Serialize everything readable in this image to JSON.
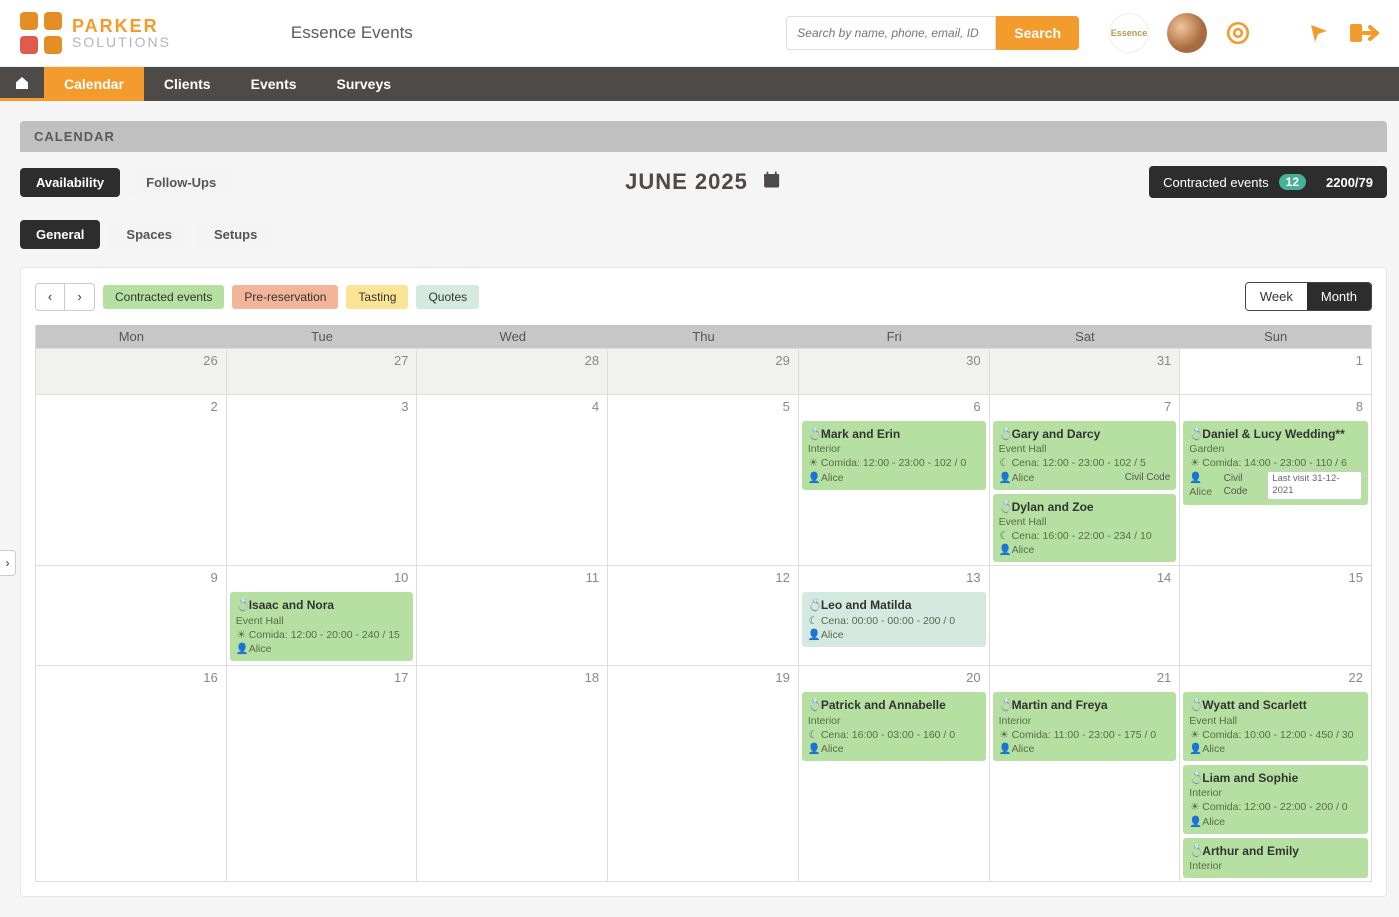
{
  "brand": {
    "line1": "PARKER",
    "line2": "SOLUTIONS"
  },
  "header": {
    "title": "Essence Events",
    "company_badge": "Essence"
  },
  "search": {
    "placeholder": "Search by name, phone, email, ID",
    "button": "Search"
  },
  "nav": {
    "home": "",
    "calendar": "Calendar",
    "clients": "Clients",
    "events": "Events",
    "surveys": "Surveys"
  },
  "section_title": "CALENDAR",
  "tabs_primary": {
    "availability": "Availability",
    "followups": "Follow-Ups"
  },
  "month_label": "JUNE 2025",
  "contracted_label": "Contracted events",
  "contracted_count": "12",
  "contracted_right": "2200/79",
  "tabs_secondary": {
    "general": "General",
    "spaces": "Spaces",
    "setups": "Setups"
  },
  "legend": {
    "contracted": "Contracted events",
    "pre": "Pre-reservation",
    "tasting": "Tasting",
    "quotes": "Quotes"
  },
  "view": {
    "week": "Week",
    "month": "Month"
  },
  "weekdays": {
    "mon": "Mon",
    "tue": "Tue",
    "wed": "Wed",
    "thu": "Thu",
    "fri": "Fri",
    "sat": "Sat",
    "sun": "Sun"
  },
  "grid": {
    "r0": [
      "26",
      "27",
      "28",
      "29",
      "30",
      "31",
      "1"
    ],
    "r1": [
      "2",
      "3",
      "4",
      "5",
      "6",
      "7",
      "8"
    ],
    "r2": [
      "9",
      "10",
      "11",
      "12",
      "13",
      "14",
      "15"
    ],
    "r3": [
      "16",
      "17",
      "18",
      "19",
      "20",
      "21",
      "22"
    ]
  },
  "events": {
    "mark_erin": {
      "title": "Mark and Erin",
      "loc": "Interior",
      "meal": "Comida: 12:00 - 23:00 - 102 / 0",
      "person": "Alice"
    },
    "gary_darcy": {
      "title": "Gary and Darcy",
      "loc": "Event Hall",
      "meal": "Cena: 12:00 - 23:00 - 102 / 5",
      "person": "Alice",
      "civil": "Civil Code"
    },
    "dylan_zoe": {
      "title": "Dylan and Zoe",
      "loc": "Event Hall",
      "meal": "Cena: 16:00 - 22:00 - 234 / 10",
      "person": "Alice"
    },
    "daniel_lucy": {
      "title": "Daniel & Lucy Wedding**",
      "loc": "Garden",
      "meal": "Comida: 14:00 - 23:00 - 110 / 6",
      "person": "Alice",
      "civil": "Civil Code",
      "visit": "Last visit 31-12-2021"
    },
    "isaac_nora": {
      "title": "Isaac and Nora",
      "loc": "Event Hall",
      "meal": "Comida: 12:00 - 20:00 - 240 / 15",
      "person": "Alice"
    },
    "leo_matilda": {
      "title": "Leo and Matilda",
      "meal": "Cena: 00:00 - 00:00 - 200 / 0",
      "person": "Alice"
    },
    "patrick_annabelle": {
      "title": "Patrick and Annabelle",
      "loc": "Interior",
      "meal": "Cena: 16:00 - 03:00 - 160 / 0",
      "person": "Alice"
    },
    "martin_freya": {
      "title": "Martin and Freya",
      "loc": "Interior",
      "meal": "Comida: 11:00 - 23:00 - 175 / 0",
      "person": "Alice"
    },
    "wyatt_scarlett": {
      "title": "Wyatt and Scarlett",
      "loc": "Event Hall",
      "meal": "Comida: 10:00 - 12:00 - 450 / 30",
      "person": "Alice"
    },
    "liam_sophie": {
      "title": "Liam and Sophie",
      "loc": "Interior",
      "meal": "Comida: 12:00 - 22:00 - 200 / 0",
      "person": "Alice"
    },
    "arthur_emily": {
      "title": "Arthur and Emily",
      "loc": "Interior"
    }
  },
  "icons": {
    "ring": "💍",
    "sun": "☀",
    "moon": "☾",
    "person": "👤"
  }
}
